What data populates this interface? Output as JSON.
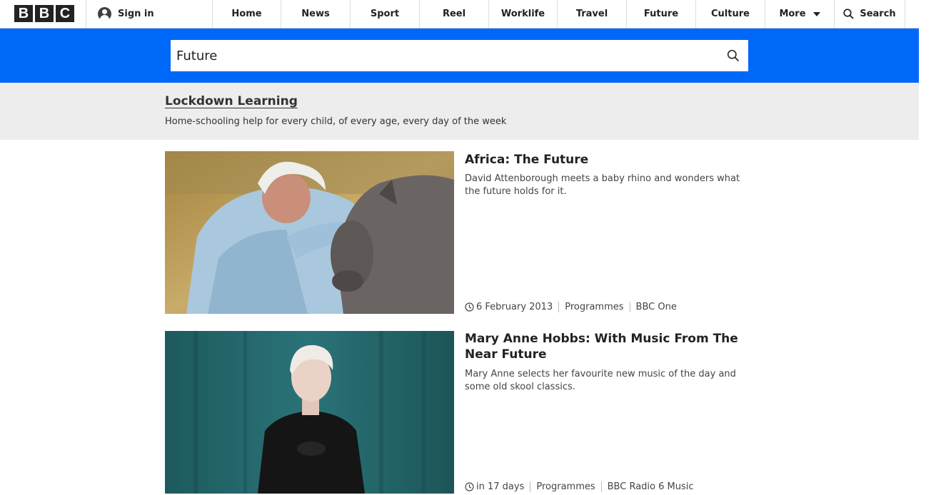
{
  "logo": {
    "letters": [
      "B",
      "B",
      "C"
    ]
  },
  "nav": {
    "sign_in": "Sign in",
    "items": [
      "Home",
      "News",
      "Sport",
      "Reel",
      "Worklife",
      "Travel",
      "Future",
      "Culture"
    ],
    "more": "More",
    "search": "Search"
  },
  "search": {
    "query": "Future"
  },
  "promo": {
    "title": "Lockdown Learning",
    "subtitle": "Home-schooling help for every child, of every age, every day of the week"
  },
  "results": [
    {
      "title": "Africa: The Future",
      "description": "David Attenborough meets a baby rhino and wonders what the future holds for it.",
      "date": "6 February 2013",
      "type": "Programmes",
      "channel": "BBC One"
    },
    {
      "title": "Mary Anne Hobbs: With Music From The Near Future",
      "description": "Mary Anne selects her favourite new music of the day and some old skool classics.",
      "date": "in 17 days",
      "type": "Programmes",
      "channel": "BBC Radio 6 Music"
    }
  ],
  "colors": {
    "band": "#0068f9",
    "promo_bg": "#ededed",
    "text": "#222222"
  }
}
